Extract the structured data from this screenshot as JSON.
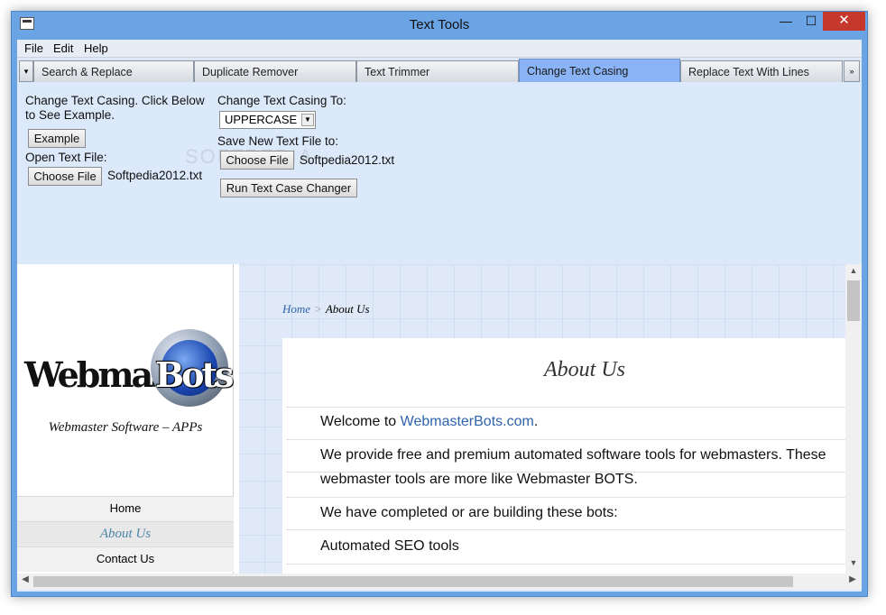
{
  "window": {
    "title": "Text Tools",
    "min_glyph": "—",
    "max_glyph": "☐",
    "close_glyph": "✕"
  },
  "menu": [
    "File",
    "Edit",
    "Help"
  ],
  "tabs": {
    "scroll_left_glyph": "▾",
    "scroll_right_glyph": "»",
    "items": [
      {
        "label": "Search & Replace"
      },
      {
        "label": "Duplicate Remover"
      },
      {
        "label": "Text Trimmer"
      },
      {
        "label": "Change Text Casing",
        "active": true
      },
      {
        "label": "Replace Text With Lines"
      }
    ]
  },
  "panel": {
    "intro_line1": "Change Text Casing. Click Below",
    "intro_line2": "to See Example.",
    "example_button": "Example",
    "open_label": "Open Text File:",
    "choose_file_button": "Choose File",
    "open_file_name": "Softpedia2012.txt",
    "casing_label": "Change Text Casing To:",
    "casing_selected": "UPPERCASE",
    "save_label": "Save New Text File to:",
    "save_choose_button": "Choose File",
    "save_file_name": "Softpedia2012.txt",
    "run_button": "Run Text Case Changer",
    "watermark": "SOFTPEDIA"
  },
  "web": {
    "logo_text_dark": "Webmaster",
    "logo_text_light": "Bots",
    "tagline": "Webmaster Software – APPs",
    "nav": [
      {
        "label": "Home"
      },
      {
        "label": "About Us",
        "active": true
      },
      {
        "label": "Contact Us"
      }
    ],
    "breadcrumb": {
      "home": "Home",
      "separator": ">",
      "current": "About Us"
    },
    "page_title": "About Us",
    "welcome_prefix": "Welcome to ",
    "welcome_link": "WebmasterBots.com",
    "welcome_suffix": ".",
    "para1_line1": "We provide free and premium automated software tools for webmasters. These",
    "para1_line2": "webmaster tools are more like Webmaster BOTS.",
    "para2": "We have completed or are building these bots:",
    "para3": "Automated SEO tools"
  },
  "colors": {
    "window_frame": "#6aa4e4",
    "close_button": "#c7382c",
    "active_tab": "#8ab4f5",
    "panel_bg": "#dce9fa",
    "link": "#2f63ac"
  }
}
